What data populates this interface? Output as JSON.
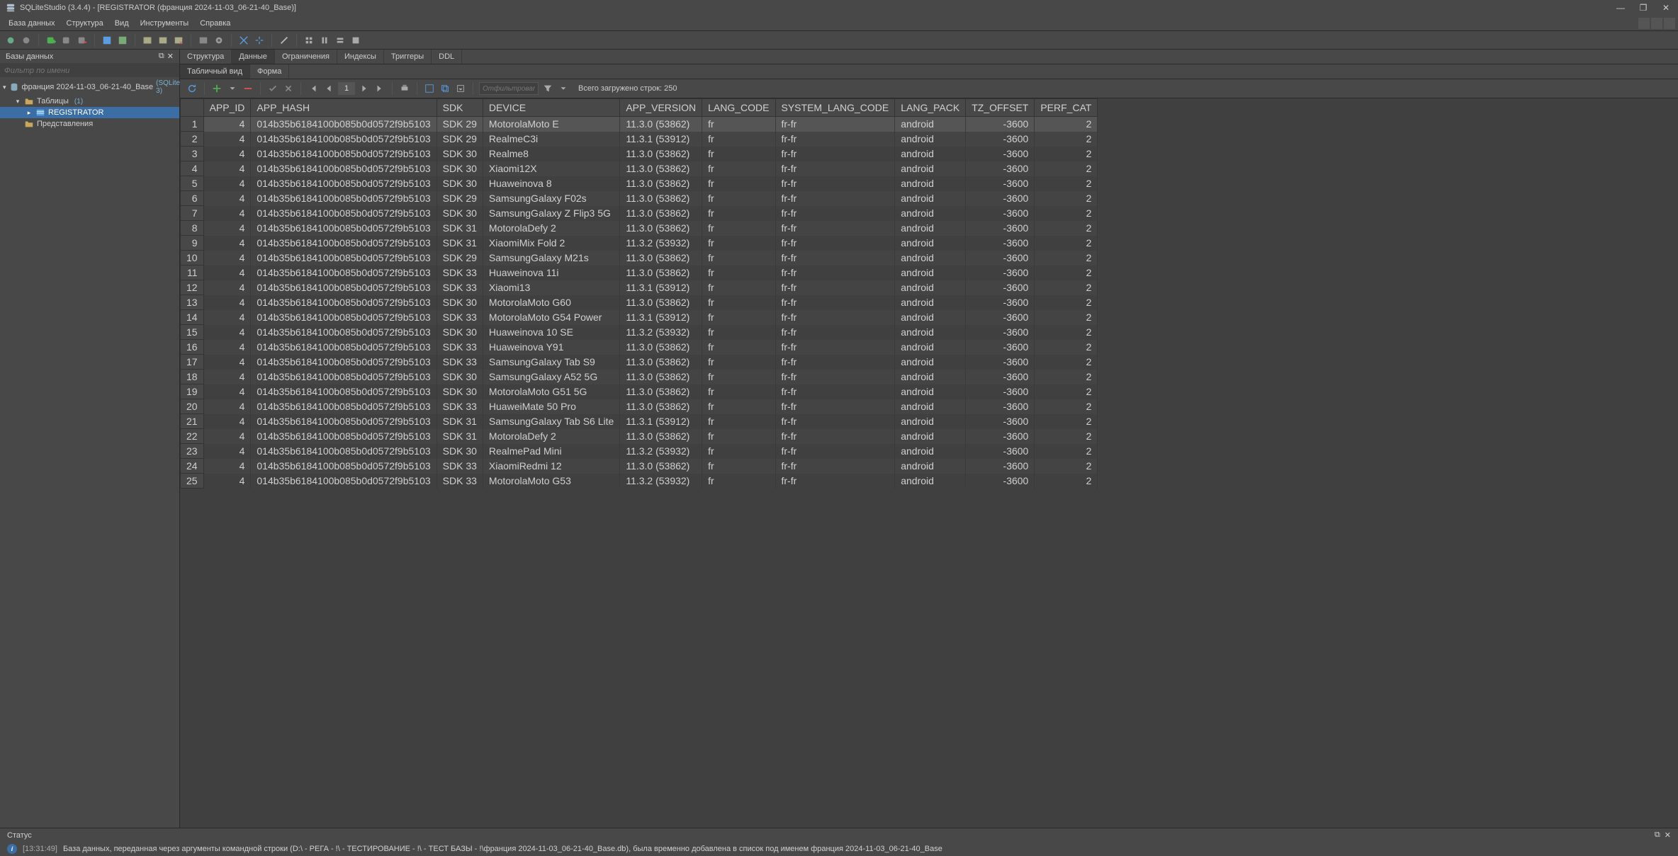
{
  "window": {
    "title": "SQLiteStudio (3.4.4) - [REGISTRATOR (франция 2024-11-03_06-21-40_Base)]"
  },
  "menu": {
    "items": [
      "База данных",
      "Структура",
      "Вид",
      "Инструменты",
      "Справка"
    ]
  },
  "db_panel": {
    "title": "Базы данных",
    "filter_placeholder": "Фильтр по имени",
    "tree": {
      "db_label": "франция 2024-11-03_06-21-40_Base",
      "db_badge": "(SQLite 3)",
      "tables_label": "Таблицы",
      "tables_count": "(1)",
      "table_name": "REGISTRATOR",
      "views_label": "Представления"
    }
  },
  "tabs1": [
    "Структура",
    "Данные",
    "Ограничения",
    "Индексы",
    "Триггеры",
    "DDL"
  ],
  "tabs2": [
    "Табличный вид",
    "Форма"
  ],
  "data_toolbar": {
    "page": "1",
    "filter_placeholder": "Отфильтровать",
    "total_text": "Всего загружено строк: 250"
  },
  "table": {
    "columns": [
      "APP_ID",
      "APP_HASH",
      "SDK",
      "DEVICE",
      "APP_VERSION",
      "LANG_CODE",
      "SYSTEM_LANG_CODE",
      "LANG_PACK",
      "TZ_OFFSET",
      "PERF_CAT"
    ],
    "rows": [
      [
        "4",
        "014b35b6184100b085b0d0572f9b5103",
        "SDK 29",
        "MotorolaMoto E",
        "11.3.0 (53862)",
        "fr",
        "fr-fr",
        "android",
        "-3600",
        "2"
      ],
      [
        "4",
        "014b35b6184100b085b0d0572f9b5103",
        "SDK 29",
        "RealmeC3i",
        "11.3.1 (53912)",
        "fr",
        "fr-fr",
        "android",
        "-3600",
        "2"
      ],
      [
        "4",
        "014b35b6184100b085b0d0572f9b5103",
        "SDK 30",
        "Realme8",
        "11.3.0 (53862)",
        "fr",
        "fr-fr",
        "android",
        "-3600",
        "2"
      ],
      [
        "4",
        "014b35b6184100b085b0d0572f9b5103",
        "SDK 30",
        "Xiaomi12X",
        "11.3.0 (53862)",
        "fr",
        "fr-fr",
        "android",
        "-3600",
        "2"
      ],
      [
        "4",
        "014b35b6184100b085b0d0572f9b5103",
        "SDK 30",
        "Huaweinova 8",
        "11.3.0 (53862)",
        "fr",
        "fr-fr",
        "android",
        "-3600",
        "2"
      ],
      [
        "4",
        "014b35b6184100b085b0d0572f9b5103",
        "SDK 29",
        "SamsungGalaxy F02s",
        "11.3.0 (53862)",
        "fr",
        "fr-fr",
        "android",
        "-3600",
        "2"
      ],
      [
        "4",
        "014b35b6184100b085b0d0572f9b5103",
        "SDK 30",
        "SamsungGalaxy Z Flip3 5G",
        "11.3.0 (53862)",
        "fr",
        "fr-fr",
        "android",
        "-3600",
        "2"
      ],
      [
        "4",
        "014b35b6184100b085b0d0572f9b5103",
        "SDK 31",
        "MotorolaDefy 2",
        "11.3.0 (53862)",
        "fr",
        "fr-fr",
        "android",
        "-3600",
        "2"
      ],
      [
        "4",
        "014b35b6184100b085b0d0572f9b5103",
        "SDK 31",
        "XiaomiMix Fold 2",
        "11.3.2 (53932)",
        "fr",
        "fr-fr",
        "android",
        "-3600",
        "2"
      ],
      [
        "4",
        "014b35b6184100b085b0d0572f9b5103",
        "SDK 29",
        "SamsungGalaxy M21s",
        "11.3.0 (53862)",
        "fr",
        "fr-fr",
        "android",
        "-3600",
        "2"
      ],
      [
        "4",
        "014b35b6184100b085b0d0572f9b5103",
        "SDK 33",
        "Huaweinova 11i",
        "11.3.0 (53862)",
        "fr",
        "fr-fr",
        "android",
        "-3600",
        "2"
      ],
      [
        "4",
        "014b35b6184100b085b0d0572f9b5103",
        "SDK 33",
        "Xiaomi13",
        "11.3.1 (53912)",
        "fr",
        "fr-fr",
        "android",
        "-3600",
        "2"
      ],
      [
        "4",
        "014b35b6184100b085b0d0572f9b5103",
        "SDK 30",
        "MotorolaMoto G60",
        "11.3.0 (53862)",
        "fr",
        "fr-fr",
        "android",
        "-3600",
        "2"
      ],
      [
        "4",
        "014b35b6184100b085b0d0572f9b5103",
        "SDK 33",
        "MotorolaMoto G54 Power",
        "11.3.1 (53912)",
        "fr",
        "fr-fr",
        "android",
        "-3600",
        "2"
      ],
      [
        "4",
        "014b35b6184100b085b0d0572f9b5103",
        "SDK 30",
        "Huaweinova 10 SE",
        "11.3.2 (53932)",
        "fr",
        "fr-fr",
        "android",
        "-3600",
        "2"
      ],
      [
        "4",
        "014b35b6184100b085b0d0572f9b5103",
        "SDK 33",
        "Huaweinova Y91",
        "11.3.0 (53862)",
        "fr",
        "fr-fr",
        "android",
        "-3600",
        "2"
      ],
      [
        "4",
        "014b35b6184100b085b0d0572f9b5103",
        "SDK 33",
        "SamsungGalaxy Tab S9",
        "11.3.0 (53862)",
        "fr",
        "fr-fr",
        "android",
        "-3600",
        "2"
      ],
      [
        "4",
        "014b35b6184100b085b0d0572f9b5103",
        "SDK 30",
        "SamsungGalaxy A52 5G",
        "11.3.0 (53862)",
        "fr",
        "fr-fr",
        "android",
        "-3600",
        "2"
      ],
      [
        "4",
        "014b35b6184100b085b0d0572f9b5103",
        "SDK 30",
        "MotorolaMoto G51 5G",
        "11.3.0 (53862)",
        "fr",
        "fr-fr",
        "android",
        "-3600",
        "2"
      ],
      [
        "4",
        "014b35b6184100b085b0d0572f9b5103",
        "SDK 33",
        "HuaweiMate 50 Pro",
        "11.3.0 (53862)",
        "fr",
        "fr-fr",
        "android",
        "-3600",
        "2"
      ],
      [
        "4",
        "014b35b6184100b085b0d0572f9b5103",
        "SDK 31",
        "SamsungGalaxy Tab S6 Lite",
        "11.3.1 (53912)",
        "fr",
        "fr-fr",
        "android",
        "-3600",
        "2"
      ],
      [
        "4",
        "014b35b6184100b085b0d0572f9b5103",
        "SDK 31",
        "MotorolaDefy 2",
        "11.3.0 (53862)",
        "fr",
        "fr-fr",
        "android",
        "-3600",
        "2"
      ],
      [
        "4",
        "014b35b6184100b085b0d0572f9b5103",
        "SDK 30",
        "RealmePad Mini",
        "11.3.2 (53932)",
        "fr",
        "fr-fr",
        "android",
        "-3600",
        "2"
      ],
      [
        "4",
        "014b35b6184100b085b0d0572f9b5103",
        "SDK 33",
        "XiaomiRedmi 12",
        "11.3.0 (53862)",
        "fr",
        "fr-fr",
        "android",
        "-3600",
        "2"
      ],
      [
        "4",
        "014b35b6184100b085b0d0572f9b5103",
        "SDK 33",
        "MotorolaMoto G53",
        "11.3.2 (53932)",
        "fr",
        "fr-fr",
        "android",
        "-3600",
        "2"
      ]
    ],
    "numeric_cols": [
      0,
      8,
      9
    ],
    "selected_row": 0
  },
  "status": {
    "label": "Статус",
    "timestamp": "[13:31:49]",
    "message": "База данных, переданная через аргументы командной строки (D:\\ - РЕГА - !\\ - ТЕСТИРОВАНИЕ - !\\ - ТЕСТ БАЗЫ - !\\франция 2024-11-03_06-21-40_Base.db), была временно добавлена в список под именем франция 2024-11-03_06-21-40_Base"
  }
}
